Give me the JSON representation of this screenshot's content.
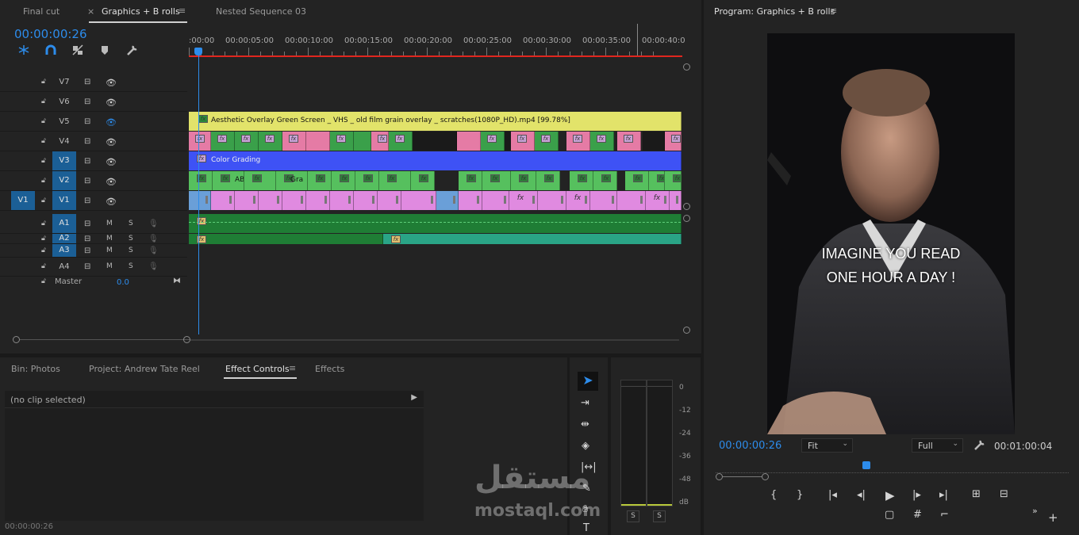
{
  "timeline": {
    "tabs": [
      {
        "label": "Final cut"
      },
      {
        "label": "Graphics + B rolls",
        "close": "×",
        "menu": "≡"
      },
      {
        "label": "Nested Sequence 03"
      }
    ],
    "timecode": "00:00:00:26",
    "ruler": ":00:00",
    "ruler_ticks": [
      "00:00:05:00",
      "00:00:10:00",
      "00:00:15:00",
      "00:00:20:00",
      "00:00:25:00",
      "00:00:30:00",
      "00:00:35:00",
      "00:00:40:0"
    ],
    "tools": [
      "snap-icon",
      "magnet-icon",
      "linked-icon",
      "marker-icon",
      "wrench-icon"
    ],
    "tracks": [
      {
        "name": "V7"
      },
      {
        "name": "V6"
      },
      {
        "name": "V5"
      },
      {
        "name": "V4"
      },
      {
        "name": "V3"
      },
      {
        "name": "V2"
      },
      {
        "name": "V1",
        "source": "V1"
      },
      {
        "name": "A1",
        "m": "M",
        "s": "S"
      },
      {
        "name": "A2",
        "m": "M",
        "s": "S"
      },
      {
        "name": "A3",
        "m": "M",
        "s": "S"
      },
      {
        "name": "A4",
        "m": "M",
        "s": "S"
      }
    ],
    "master_label": "Master",
    "master_value": "0.0",
    "clips": {
      "v5_label": "Aesthetic Overlay Green Screen _ VHS _ old film grain overlay _ scratches(1080P_HD).mp4 [99.78%]",
      "v3_label": "Color Grading",
      "v2_labels": [
        "ABO",
        "Gra"
      ],
      "fx": "fx"
    }
  },
  "program": {
    "title": "Program: Graphics + B rolls",
    "menu": "≡",
    "caption_line1": "IMAGINE YOU READ",
    "caption_line2": "ONE HOUR A DAY !",
    "timecode": "00:00:00:26",
    "fit": "Fit",
    "full": "Full",
    "duration": "00:01:00:04"
  },
  "bottom": {
    "tabs": [
      {
        "label": "Bin: Photos"
      },
      {
        "label": "Project: Andrew Tate Reel"
      },
      {
        "label": "Effect Controls",
        "menu": "≡"
      },
      {
        "label": "Effects"
      }
    ],
    "no_clip": "(no clip selected)",
    "timecode": "00:00:00:26"
  },
  "meter": {
    "scale": [
      "0",
      "-12",
      "-24",
      "-36",
      "-48",
      "dB"
    ],
    "solo": [
      "S",
      "S"
    ]
  },
  "watermark": {
    "arabic": "مستقل",
    "latin": "mostaql.com"
  },
  "colors": {
    "accent": "#2d8ceb",
    "playhead": "#2d8ceb",
    "yellow_clip": "#e2e36a",
    "pink_clip": "#e57ba5",
    "green_clip": "#3aa04a",
    "blue_clip": "#3e52f5",
    "v2_green": "#56c05e",
    "v1_pink": "#e08ae0",
    "audio_green": "#1f7d35"
  }
}
